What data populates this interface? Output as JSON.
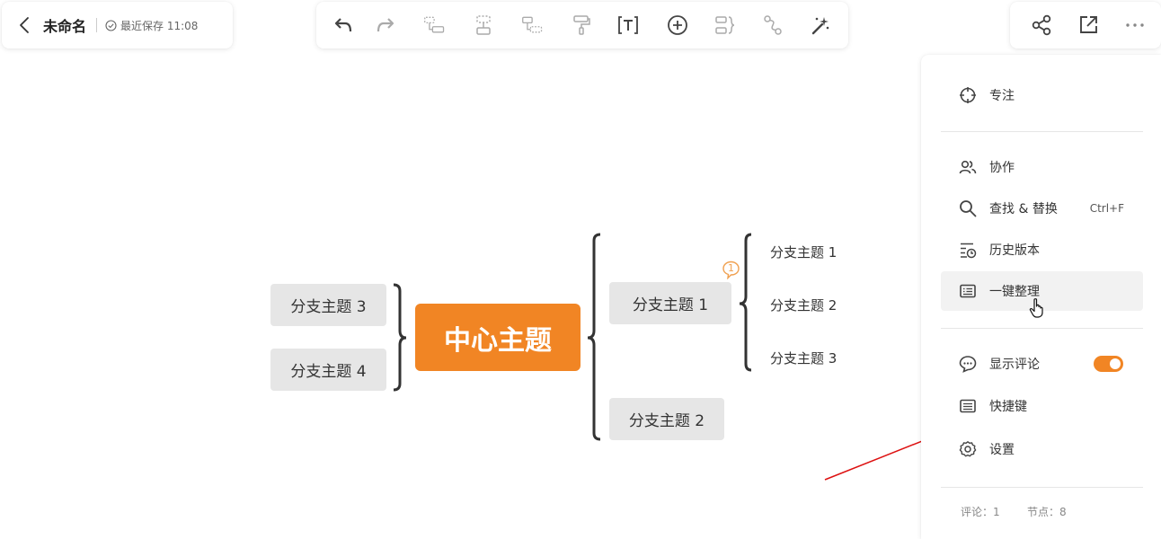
{
  "header": {
    "title": "未命名",
    "save_status": "最近保存 11:08"
  },
  "toolbar": {
    "buttons": [
      {
        "name": "undo",
        "icon": "undo-icon"
      },
      {
        "name": "redo",
        "icon": "redo-icon"
      },
      {
        "name": "insert-child-topic",
        "icon": "child-topic-icon"
      },
      {
        "name": "insert-sibling-topic",
        "icon": "sibling-topic-icon"
      },
      {
        "name": "insert-parent-topic",
        "icon": "parent-topic-icon"
      },
      {
        "name": "format-painter",
        "icon": "paint-roller-icon"
      },
      {
        "name": "text",
        "icon": "text-icon"
      },
      {
        "name": "insert",
        "icon": "plus-circle-icon"
      },
      {
        "name": "summary",
        "icon": "summary-icon"
      },
      {
        "name": "relationship",
        "icon": "relationship-icon"
      },
      {
        "name": "ai-magic",
        "icon": "magic-wand-icon"
      }
    ]
  },
  "actions": [
    {
      "name": "share",
      "icon": "share-icon"
    },
    {
      "name": "export",
      "icon": "export-icon"
    },
    {
      "name": "more",
      "icon": "more-icon"
    }
  ],
  "menu": {
    "items": [
      {
        "label": "专注",
        "icon": "focus-icon",
        "shortcut": ""
      },
      {
        "label": "协作",
        "icon": "collaborate-icon",
        "shortcut": ""
      },
      {
        "label": "查找 & 替换",
        "icon": "search-icon",
        "shortcut": "Ctrl+F"
      },
      {
        "label": "历史版本",
        "icon": "history-icon",
        "shortcut": ""
      },
      {
        "label": "一键整理",
        "icon": "tidy-icon",
        "shortcut": ""
      },
      {
        "label": "显示评论",
        "icon": "comment-icon",
        "shortcut": ""
      },
      {
        "label": "快捷键",
        "icon": "keyboard-icon",
        "shortcut": ""
      },
      {
        "label": "设置",
        "icon": "gear-icon",
        "shortcut": ""
      }
    ],
    "show_comments_enabled": true,
    "footer": {
      "comments": "评论：1",
      "nodes": "节点：8"
    }
  },
  "mindmap": {
    "center": "中心主题",
    "left_branches": [
      "分支主题 3",
      "分支主题 4"
    ],
    "right_branches": [
      "分支主题 1",
      "分支主题 2"
    ],
    "sub_branches": [
      "分支主题 1",
      "分支主题 2",
      "分支主题 3"
    ],
    "comment_count": "1"
  },
  "colors": {
    "accent": "#f18524",
    "node_bg": "#e6e6e6",
    "arrow": "#dd1111"
  }
}
